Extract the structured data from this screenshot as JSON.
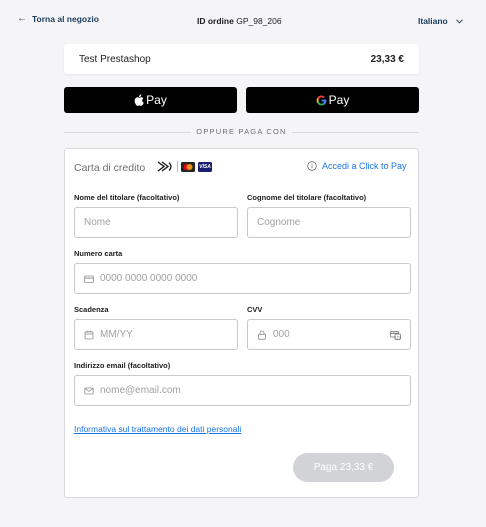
{
  "header": {
    "back_label": "Torna al negozio",
    "order_id_label": "ID ordine",
    "order_id_value": "GP_98_206",
    "language": "Italiano"
  },
  "summary": {
    "shop_name": "Test Prestashop",
    "amount": "23,33 €"
  },
  "wallets": {
    "apple_label": "Pay",
    "google_label": "Pay"
  },
  "divider_text": "OPPURE PAGA CON",
  "card_form": {
    "title": "Carta di credito",
    "visa_text": "VISA",
    "click_to_pay_label": "Accedi a Click to Pay",
    "first_name_label": "Nome del titolare (facoltativo)",
    "first_name_placeholder": "Nome",
    "last_name_label": "Cognome del titolare (facoltativo)",
    "last_name_placeholder": "Cognome",
    "card_number_label": "Numero carta",
    "card_number_placeholder": "0000 0000 0000 0000",
    "expiry_label": "Scadenza",
    "expiry_placeholder": "MM/YY",
    "cvv_label": "CVV",
    "cvv_placeholder": "000",
    "email_label": "Indirizzo email (facoltativo)",
    "email_placeholder": "nome@email.com",
    "privacy_link": "Informativa sul trattamento dei dati personali",
    "pay_button": "Paga 23,33 €"
  },
  "colors": {
    "accent": "#1a73e8",
    "nav_text": "#1a3a5c",
    "pay_button_disabled": "#d2d3d6",
    "wallet_button": "#000000"
  }
}
